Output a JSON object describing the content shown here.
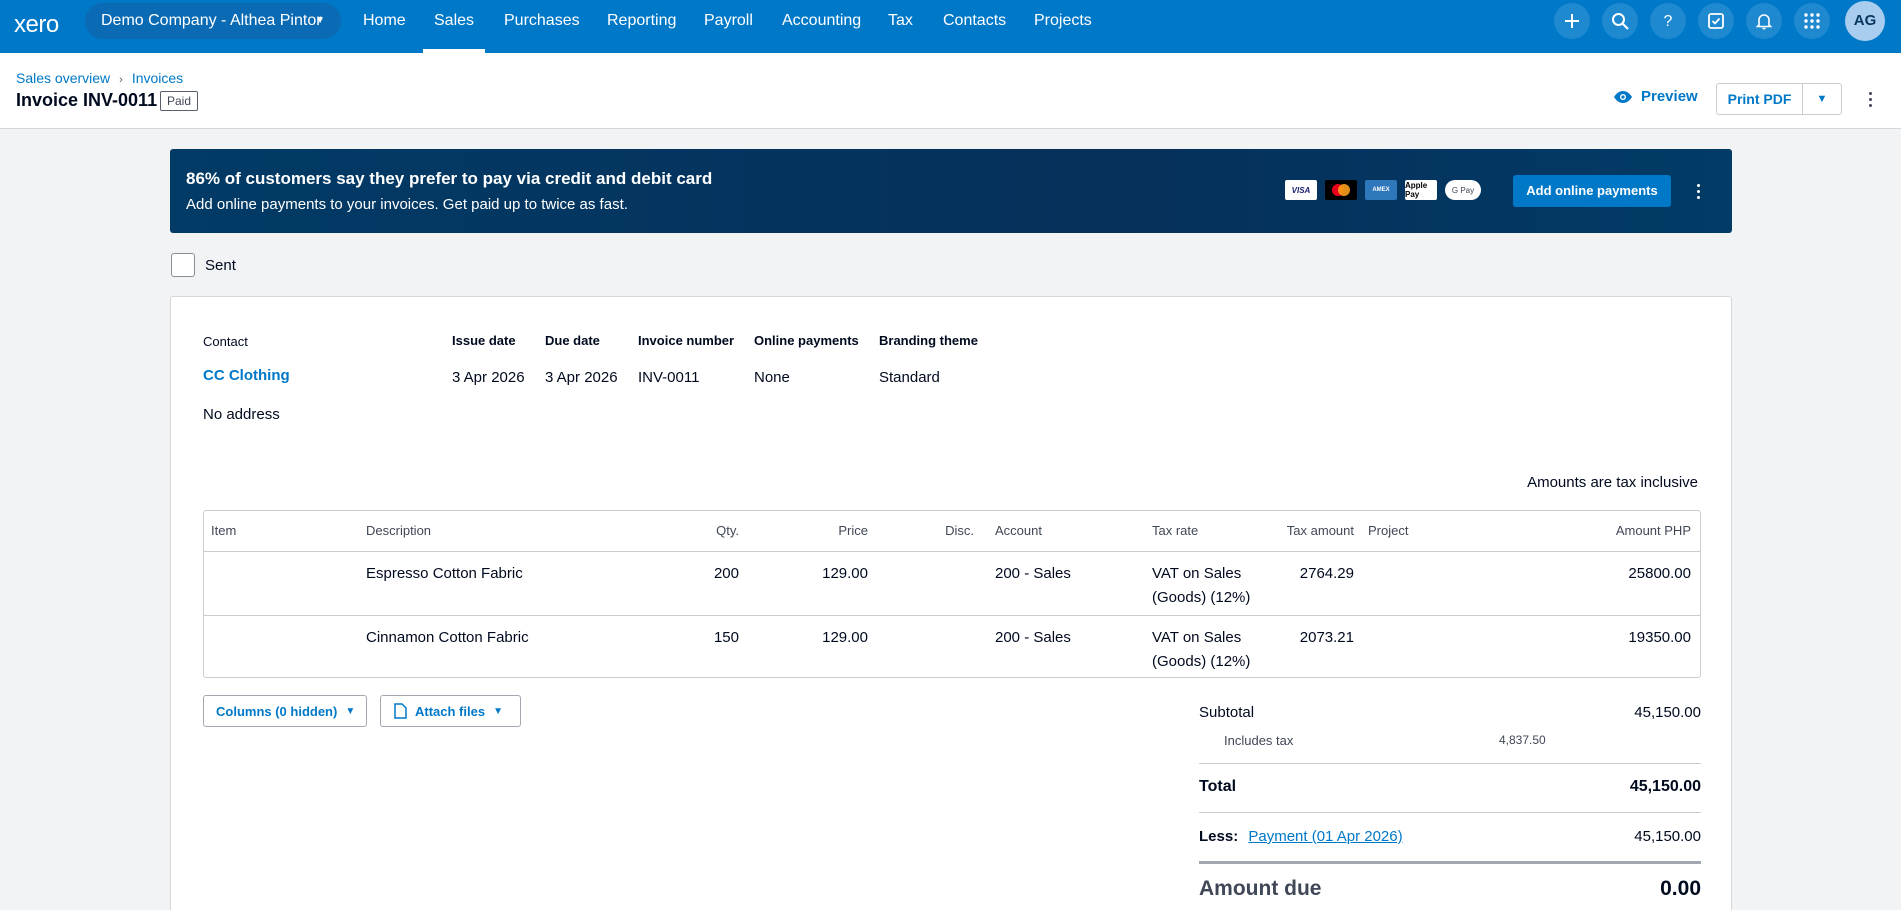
{
  "nav": {
    "logo": "xero",
    "org": "Demo Company - Althea Pintor",
    "links": [
      "Home",
      "Sales",
      "Purchases",
      "Reporting",
      "Payroll",
      "Accounting",
      "Tax",
      "Contacts",
      "Projects"
    ],
    "active": "Sales",
    "avatar": "AG",
    "icons": [
      "plus-icon",
      "search-icon",
      "help-icon",
      "tasks-icon",
      "bell-icon",
      "apps-grid-icon"
    ]
  },
  "header": {
    "crumbs": [
      "Sales overview",
      "Invoices"
    ],
    "title": "Invoice INV-0011",
    "status": "Paid",
    "preview": "Preview",
    "print": "Print PDF"
  },
  "banner": {
    "headline": "86% of customers say they prefer to pay via credit and debit card",
    "sub": "Add online payments to your invoices. Get paid up to twice as fast.",
    "cards": [
      "VISA",
      "Mastercard",
      "AMEX",
      "Apple Pay",
      "G Pay"
    ],
    "button": "Add online payments"
  },
  "sent": {
    "label": "Sent",
    "checked": false
  },
  "invoice": {
    "contact_label": "Contact",
    "contact": "CC Clothing",
    "address": "No address",
    "fields": [
      {
        "label": "Issue date",
        "value": "3 Apr 2026"
      },
      {
        "label": "Due date",
        "value": "3 Apr 2026"
      },
      {
        "label": "Invoice number",
        "value": "INV-0011"
      },
      {
        "label": "Online payments",
        "value": "None"
      },
      {
        "label": "Branding theme",
        "value": "Standard"
      }
    ],
    "tax_note": "Amounts are tax inclusive",
    "columns": [
      "Item",
      "Description",
      "Qty.",
      "Price",
      "Disc.",
      "Account",
      "Tax rate",
      "Tax amount",
      "Project",
      "Amount PHP"
    ],
    "rows": [
      {
        "item": "",
        "description": "Espresso Cotton Fabric",
        "qty": "200",
        "price": "129.00",
        "disc": "",
        "account": "200 - Sales",
        "tax_rate_1": "VAT on Sales",
        "tax_rate_2": "(Goods) (12%)",
        "tax_amount": "2764.29",
        "project": "",
        "amount": "25800.00"
      },
      {
        "item": "",
        "description": "Cinnamon Cotton Fabric",
        "qty": "150",
        "price": "129.00",
        "disc": "",
        "account": "200 - Sales",
        "tax_rate_1": "VAT on Sales",
        "tax_rate_2": "(Goods) (12%)",
        "tax_amount": "2073.21",
        "project": "",
        "amount": "19350.00"
      }
    ],
    "columns_button": "Columns (0 hidden)",
    "attach_button": "Attach files",
    "totals": {
      "subtotal_label": "Subtotal",
      "subtotal": "45,150.00",
      "includes_tax_label": "Includes tax",
      "includes_tax": "4,837.50",
      "total_label": "Total",
      "total": "45,150.00",
      "less_label": "Less:",
      "payment_link": "Payment (01 Apr 2026)",
      "payment": "45,150.00",
      "amount_due_label": "Amount due",
      "amount_due": "0.00"
    }
  }
}
